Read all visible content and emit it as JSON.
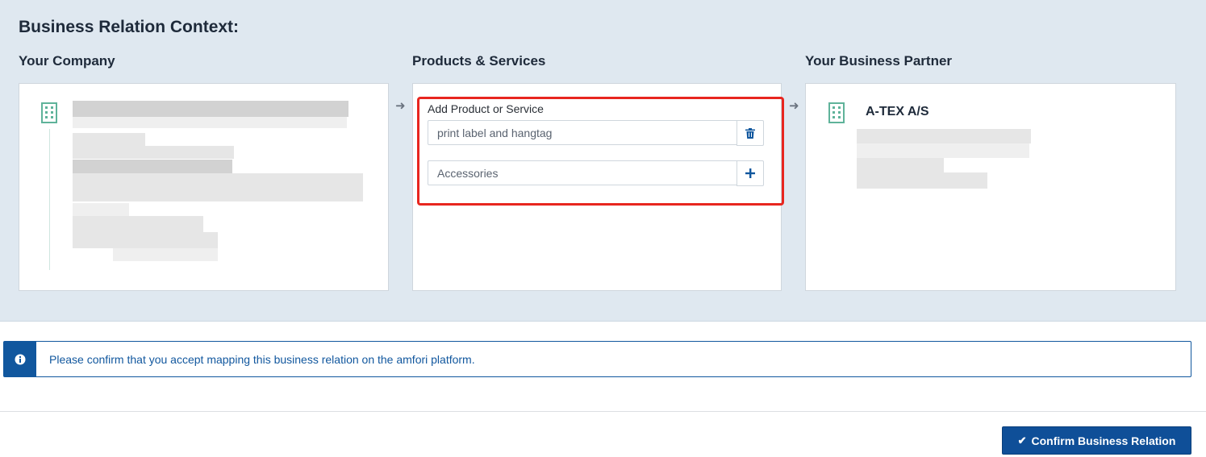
{
  "context": {
    "title": "Business Relation Context:",
    "your_company_label": "Your Company",
    "products_label": "Products & Services",
    "partner_label": "Your Business Partner"
  },
  "products": {
    "add_label": "Add Product or Service",
    "entries": [
      {
        "value": "print label and hangtag",
        "action_icon": "trash-icon"
      }
    ],
    "new_entry": {
      "placeholder": "Accessories",
      "action_icon": "plus-icon"
    }
  },
  "partner": {
    "name": "A-TEX A/S",
    "icon": "building-icon"
  },
  "company": {
    "icon": "building-icon"
  },
  "alert": {
    "icon": "info-icon",
    "text": "Please confirm that you accept mapping this business relation on the amfori platform."
  },
  "actions": {
    "confirm_label": "Confirm Business Relation",
    "confirm_icon": "checkmark-icon"
  },
  "colors": {
    "context_bg": "#dfe8f0",
    "primary": "#0f4f98",
    "building_icon": "#5fb39a",
    "highlight": "#e8261f"
  }
}
